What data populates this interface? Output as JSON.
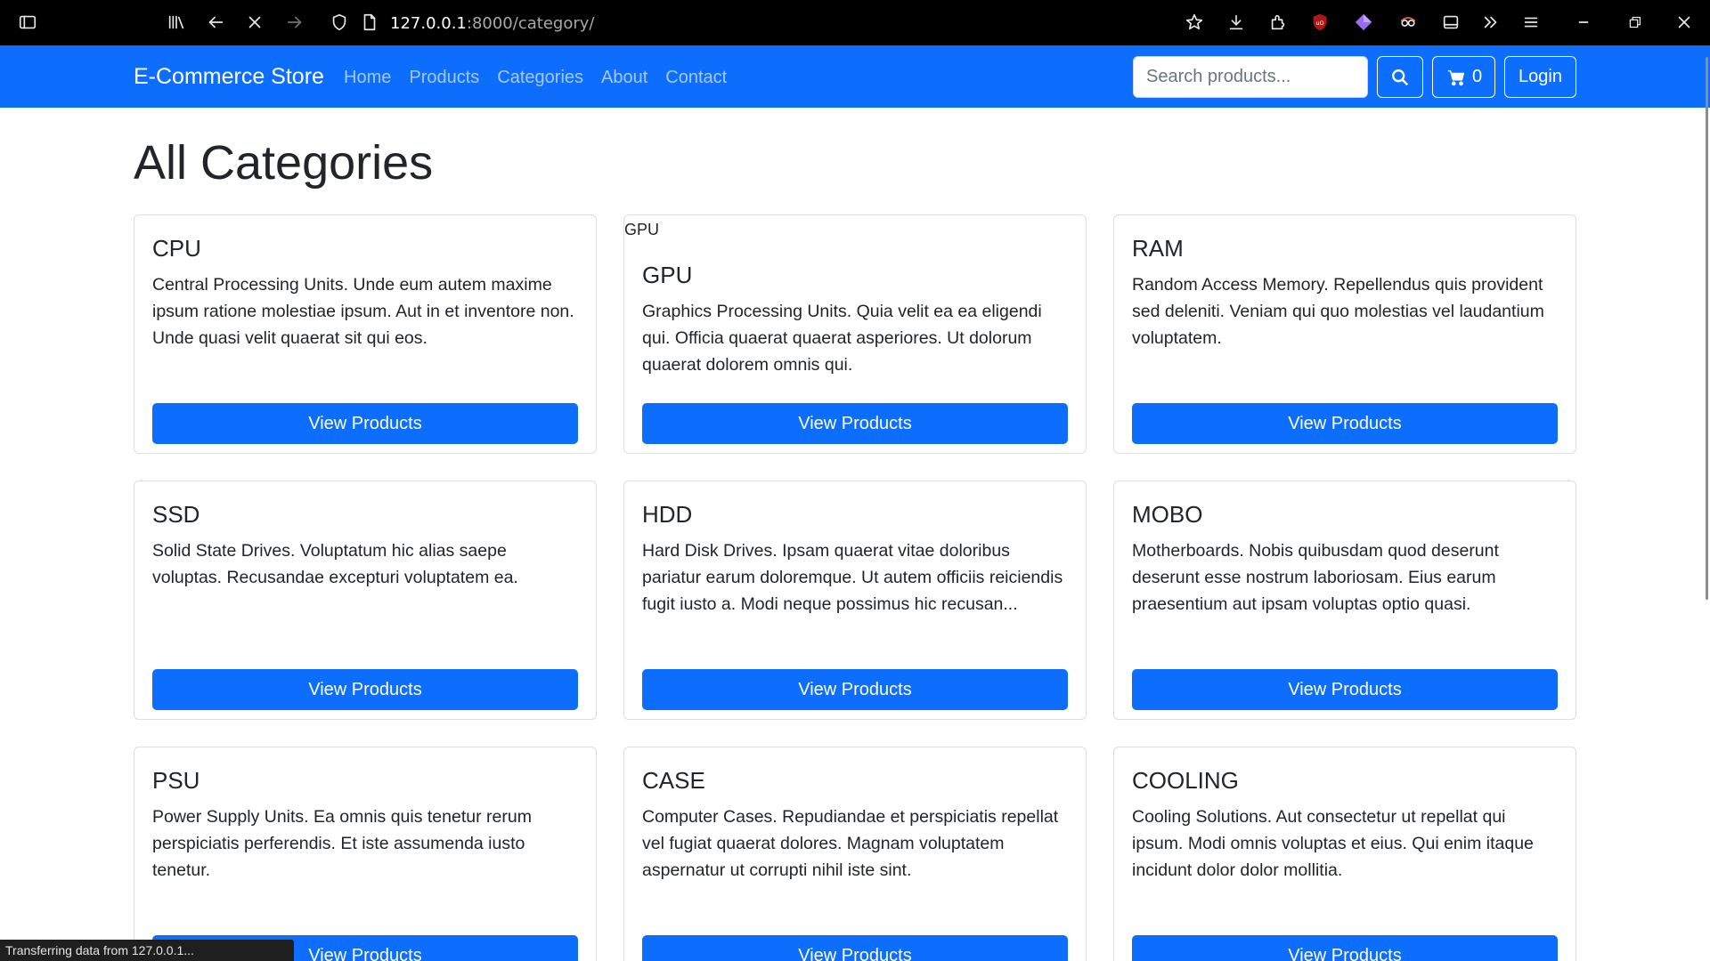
{
  "browser": {
    "url_host": "127.0.0.1",
    "url_rest": ":8000/category/"
  },
  "navbar": {
    "brand": "E-Commerce Store",
    "links": [
      "Home",
      "Products",
      "Categories",
      "About",
      "Contact"
    ],
    "search_placeholder": "Search products...",
    "cart_count": "0",
    "login_label": "Login"
  },
  "page": {
    "title": "All Categories"
  },
  "categories": [
    {
      "name": "CPU",
      "description": "Central Processing Units. Unde eum autem maxime ipsum ratione molestiae ipsum. Aut in et inventore non. Unde quasi velit quaerat sit qui eos.",
      "button": "View Products"
    },
    {
      "name": "GPU",
      "image_alt": "GPU",
      "description": "Graphics Processing Units. Quia velit ea ea eligendi qui. Officia quaerat quaerat asperiores. Ut dolorum quaerat dolorem omnis qui.",
      "button": "View Products"
    },
    {
      "name": "RAM",
      "description": "Random Access Memory. Repellendus quis provident sed deleniti. Veniam qui quo molestias vel laudantium voluptatem.",
      "button": "View Products"
    },
    {
      "name": "SSD",
      "description": "Solid State Drives. Voluptatum hic alias saepe voluptas. Recusandae excepturi voluptatem ea.",
      "button": "View Products"
    },
    {
      "name": "HDD",
      "description": "Hard Disk Drives. Ipsam quaerat vitae doloribus pariatur earum doloremque. Ut autem officiis reiciendis fugit iusto a. Modi neque possimus hic recusan...",
      "button": "View Products"
    },
    {
      "name": "MOBO",
      "description": "Motherboards. Nobis quibusdam quod deserunt deserunt esse nostrum laboriosam. Eius earum praesentium aut ipsam voluptas optio quasi.",
      "button": "View Products"
    },
    {
      "name": "PSU",
      "description": "Power Supply Units. Ea omnis quis tenetur rerum perspiciatis perferendis. Et iste assumenda iusto tenetur.",
      "button": "View Products"
    },
    {
      "name": "CASE",
      "description": "Computer Cases. Repudiandae et perspiciatis repellat vel fugiat quaerat dolores. Magnam voluptatem aspernatur ut corrupti nihil iste sint.",
      "button": "View Products"
    },
    {
      "name": "COOLING",
      "description": "Cooling Solutions. Aut consectetur ut repellat qui ipsum. Modi omnis voluptas et eius. Qui enim itaque incidunt dolor dolor mollitia.",
      "button": "View Products"
    }
  ],
  "status": "Transferring data from 127.0.0.1...",
  "colors": {
    "primary": "#0d6efd",
    "browser_bar": "#000000"
  }
}
